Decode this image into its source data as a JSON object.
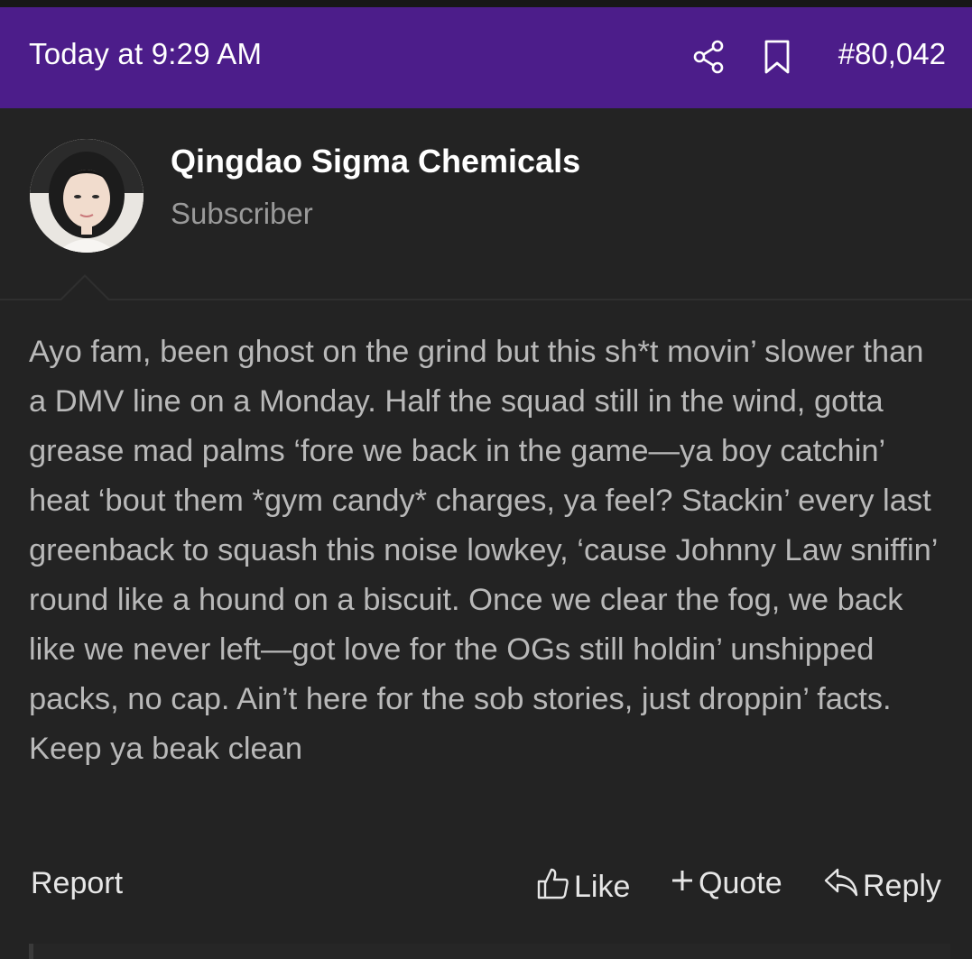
{
  "post": {
    "timestamp": "Today at 9:29 AM",
    "post_number": "#80,042",
    "author": {
      "name": "Qingdao Sigma Chemicals",
      "role": "Subscriber"
    },
    "body": "Ayo fam, been ghost on the grind but this sh*t movin’ slower than a DMV line on a Monday. Half the squad still in the wind, gotta grease mad palms ‘fore we back in the game—ya boy catchin’ heat ‘bout them *gym candy* charges, ya feel? Stackin’ every last greenback to squash this noise lowkey, ‘cause Johnny Law sniffin’ round like a hound on a biscuit. Once we clear the fog, we back like we never left—got love for the OGs still holdin’ unshipped packs, no cap. Ain’t here for the sob stories, just droppin’ facts. Keep ya beak clean"
  },
  "actions": {
    "report": "Report",
    "like": "Like",
    "quote": "Quote",
    "reply": "Reply"
  },
  "icons": {
    "share": "share-icon",
    "bookmark": "bookmark-icon",
    "like": "thumbs-up-icon",
    "quote": "plus-icon",
    "reply": "reply-icon"
  },
  "colors": {
    "header_bg": "#4c1d8a",
    "page_bg": "#232323",
    "username": "#ffffff",
    "role": "#9a9a9a",
    "body_text": "#b9b9b9"
  }
}
